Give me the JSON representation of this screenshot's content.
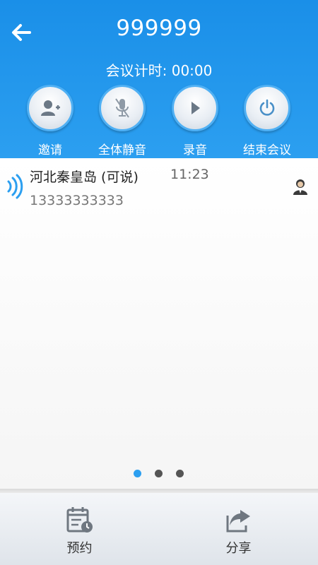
{
  "header": {
    "title": "999999",
    "timer_label": "会议计时: 00:00"
  },
  "actions": [
    {
      "label": "邀请",
      "icon": "add-user-icon"
    },
    {
      "label": "全体静音",
      "icon": "microphone-mute-icon"
    },
    {
      "label": "录音",
      "icon": "play-icon"
    },
    {
      "label": "结束会议",
      "icon": "power-icon"
    }
  ],
  "members": [
    {
      "name": "河北秦皇岛 (可说)",
      "time": "11:23",
      "phone": "13333333333",
      "icon": "speaking-icon",
      "avatar": "user-avatar-icon"
    }
  ],
  "pager": {
    "count": 3,
    "active": 0
  },
  "bottom_tabs": [
    {
      "label": "预约",
      "icon": "calendar-clock-icon"
    },
    {
      "label": "分享",
      "icon": "share-icon"
    }
  ],
  "colors": {
    "primary": "#2c9ff0",
    "header_top": "#1a8fe8",
    "ring": "#4fb0f4",
    "icon_gray": "#6b7886"
  }
}
